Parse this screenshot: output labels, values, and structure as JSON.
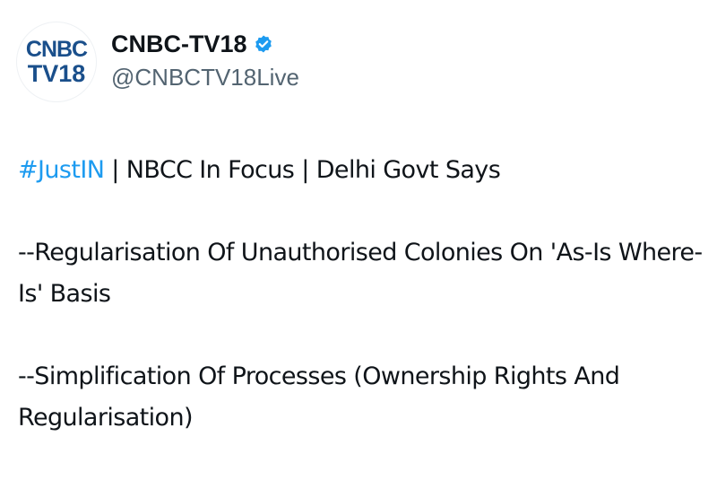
{
  "author": {
    "display_name": "CNBC-TV18",
    "handle": "@CNBCTV18Live",
    "verified": true,
    "avatar": {
      "logo_top": "CNBC",
      "logo_bottom": "TV18"
    }
  },
  "tweet": {
    "line1": {
      "hashtag": "#JustIN",
      "rest": " | NBCC In Focus | Delhi Govt Says"
    },
    "point1": "--Regularisation Of Unauthorised Colonies On 'As-Is Where-Is' Basis",
    "point2": "--Simplification Of Processes (Ownership Rights And Regularisation)"
  },
  "colors": {
    "hashtag": "#1d9bf0",
    "verified_badge": "#1d9bf0",
    "handle": "#536471",
    "text": "#0f1419",
    "logo": "#1a4f8b"
  },
  "icons": {
    "verified": "verified-badge-icon"
  }
}
